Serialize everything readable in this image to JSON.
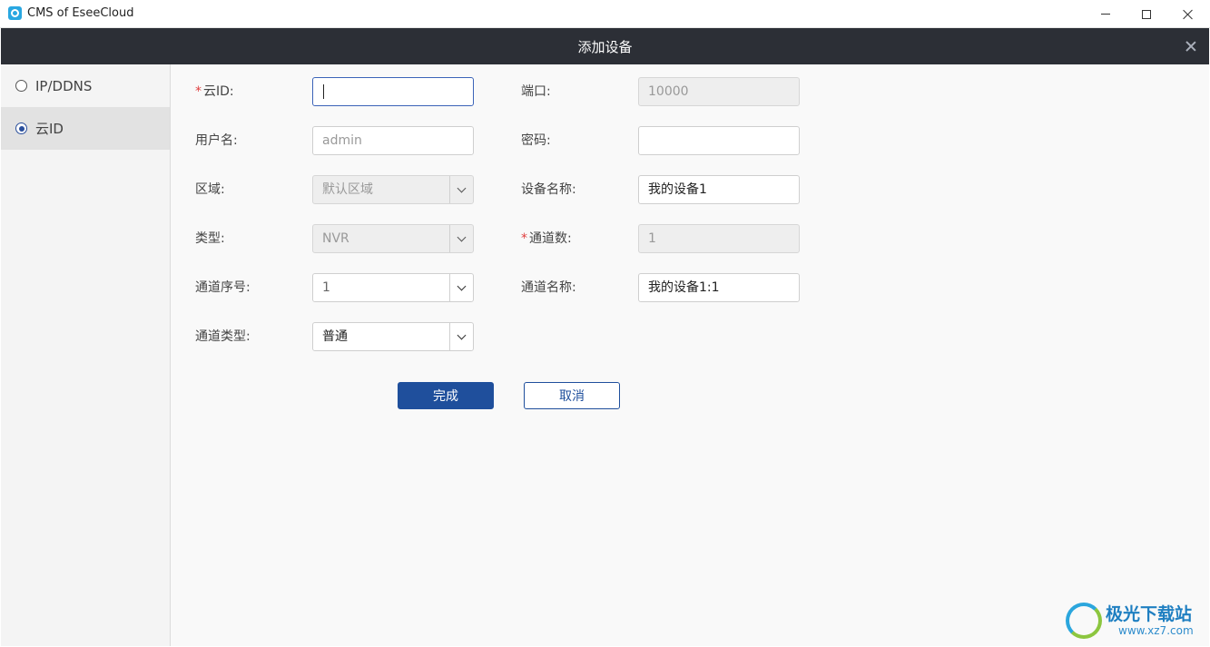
{
  "window": {
    "title": "CMS of EseeCloud"
  },
  "dialog": {
    "title": "添加设备"
  },
  "sidebar": {
    "items": [
      {
        "label": "IP/DDNS",
        "selected": false
      },
      {
        "label": "云ID",
        "selected": true
      }
    ]
  },
  "form": {
    "cloud_id": {
      "label": "云ID",
      "required_mark": "*",
      "value": ""
    },
    "port": {
      "label": "端口",
      "value": "10000"
    },
    "username": {
      "label": "用户名",
      "placeholder": "admin"
    },
    "password": {
      "label": "密码",
      "value": ""
    },
    "region": {
      "label": "区域",
      "value": "默认区域"
    },
    "device_name": {
      "label": "设备名称",
      "value": "我的设备1"
    },
    "type": {
      "label": "类型",
      "value": "NVR"
    },
    "channel_count": {
      "label": "通道数",
      "required_mark": "*",
      "value": "1"
    },
    "channel_index": {
      "label": "通道序号",
      "value": "1"
    },
    "channel_name": {
      "label": "通道名称",
      "value": "我的设备1:1"
    },
    "channel_type": {
      "label": "通道类型",
      "value": "普通"
    },
    "colon": ":"
  },
  "buttons": {
    "done": "完成",
    "cancel": "取消"
  },
  "watermark": {
    "brand": "极光下载站",
    "url": "www.xz7.com"
  },
  "colors": {
    "header_bg": "#2c2f36",
    "primary": "#1f4f9c",
    "required": "#e04040"
  }
}
